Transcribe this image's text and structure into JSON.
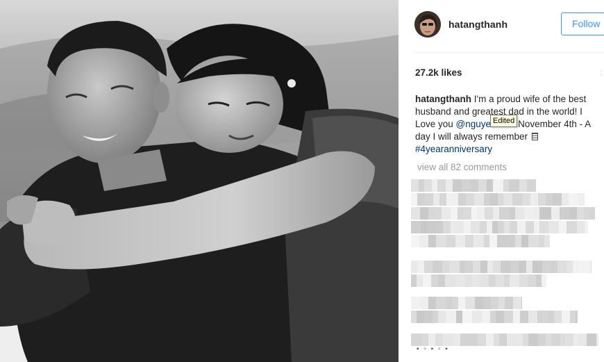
{
  "post": {
    "username": "hatangthanh",
    "follow_label": "Follow",
    "likes": "27.2k likes",
    "caption": {
      "user": "hatangthanh",
      "text_1": " I'm a proud wife of the best husband and greatest dad in the world! I Love you ",
      "mention": "@nguyenlouis",
      "text_2": " November 4th - A day I will always remember ",
      "hashtag": "#4yearanniversary"
    },
    "tooltip": "Edited",
    "view_comments": "view all 82 comments",
    "more_indicator": ":"
  },
  "colors": {
    "accent_blue": "#3897f0",
    "hashtag": "#003569",
    "muted_gray": "#999999"
  },
  "icons": {
    "flag": "flag-icon"
  }
}
